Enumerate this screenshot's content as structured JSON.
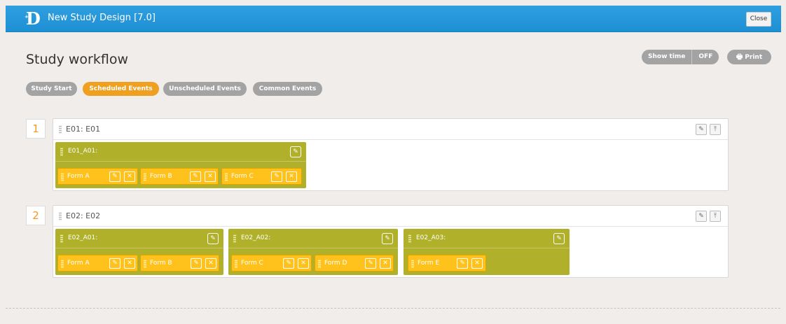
{
  "app": {
    "title": "New Study Design [7.0]",
    "logo": "D",
    "close_label": "Close"
  },
  "page": {
    "title": "Study workflow"
  },
  "toolbar": {
    "show_time_label": "Show time",
    "show_time_state": "OFF",
    "print_label": "Print"
  },
  "tabs": [
    {
      "label": "Study Start",
      "active": false
    },
    {
      "label": "Scheduled Events",
      "active": true
    },
    {
      "label": "Unscheduled Events",
      "active": false
    },
    {
      "label": "Common Events",
      "active": false
    }
  ],
  "events": [
    {
      "number": "1",
      "label": "E01: E01",
      "arms": [
        {
          "label": "E01_A01:",
          "forms": [
            "Form A",
            "Form B",
            "Form C"
          ]
        }
      ]
    },
    {
      "number": "2",
      "label": "E02: E02",
      "arms": [
        {
          "label": "E02_A01:",
          "forms": [
            "Form A",
            "Form B"
          ]
        },
        {
          "label": "E02_A02:",
          "forms": [
            "Form C",
            "Form D"
          ]
        },
        {
          "label": "E02_A03:",
          "forms": [
            "Form E"
          ]
        }
      ]
    }
  ],
  "colors": {
    "header_blue": "#2196d9",
    "active_tab": "#f0a020",
    "arm_olive": "#b0b02a",
    "form_yellow": "#ffc21c",
    "step_number": "#f09a1e"
  },
  "icons": {
    "edit": "pencil-icon",
    "delete": "close-icon",
    "move_top": "move-to-top-icon",
    "print": "printer-icon"
  }
}
